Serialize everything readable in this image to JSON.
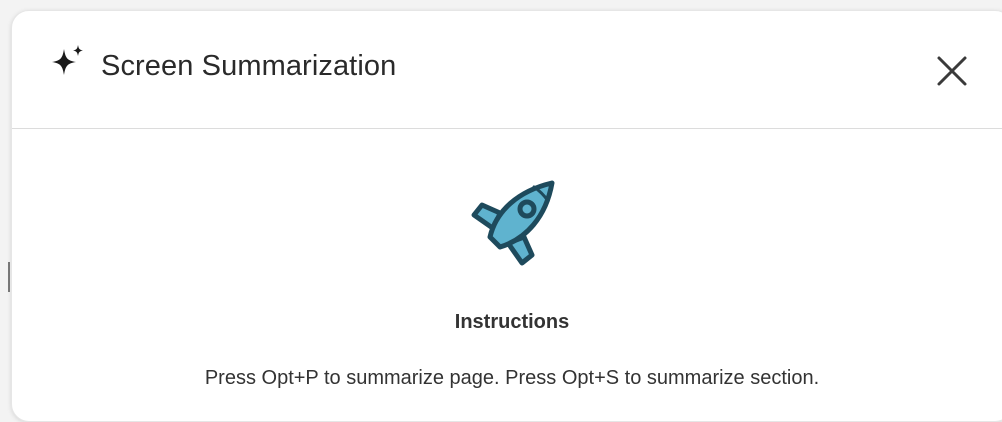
{
  "dialog": {
    "title": "Screen Summarization",
    "title_icon": "sparkle-icon",
    "close_icon": "close-icon"
  },
  "content": {
    "illustration": "rocket-icon",
    "heading": "Instructions",
    "text": "Press Opt+P to summarize page. Press Opt+S to summarize section."
  },
  "colors": {
    "rocket_fill": "#5fb3cf",
    "rocket_stroke": "#1e4a5c",
    "text": "#2a2a2a"
  }
}
